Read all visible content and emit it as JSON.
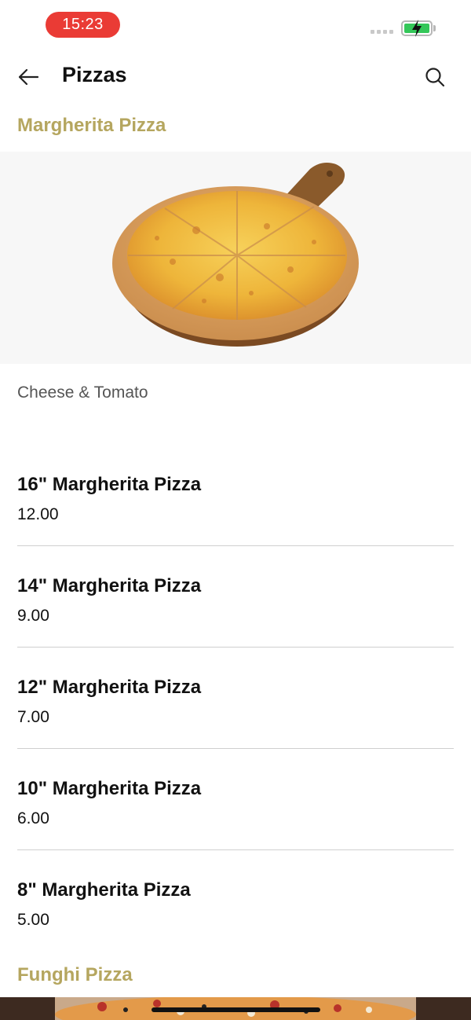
{
  "status": {
    "time": "15:23"
  },
  "app_bar": {
    "title": "Pizzas"
  },
  "sections": [
    {
      "title": "Margherita Pizza",
      "description": "Cheese & Tomato",
      "items": [
        {
          "name": "16\" Margherita Pizza",
          "price": "12.00"
        },
        {
          "name": "14\" Margherita Pizza",
          "price": "9.00"
        },
        {
          "name": "12\" Margherita Pizza",
          "price": "7.00"
        },
        {
          "name": "10\" Margherita Pizza",
          "price": "6.00"
        },
        {
          "name": "8\" Margherita Pizza",
          "price": "5.00"
        }
      ]
    },
    {
      "title": "Funghi Pizza"
    }
  ],
  "icons": {
    "back": "arrow-left-icon",
    "search": "search-icon",
    "battery": "battery-charging-icon"
  },
  "colors": {
    "section_title": "#b5a65f",
    "time_pill": "#ea3b35",
    "battery": "#34c759"
  }
}
